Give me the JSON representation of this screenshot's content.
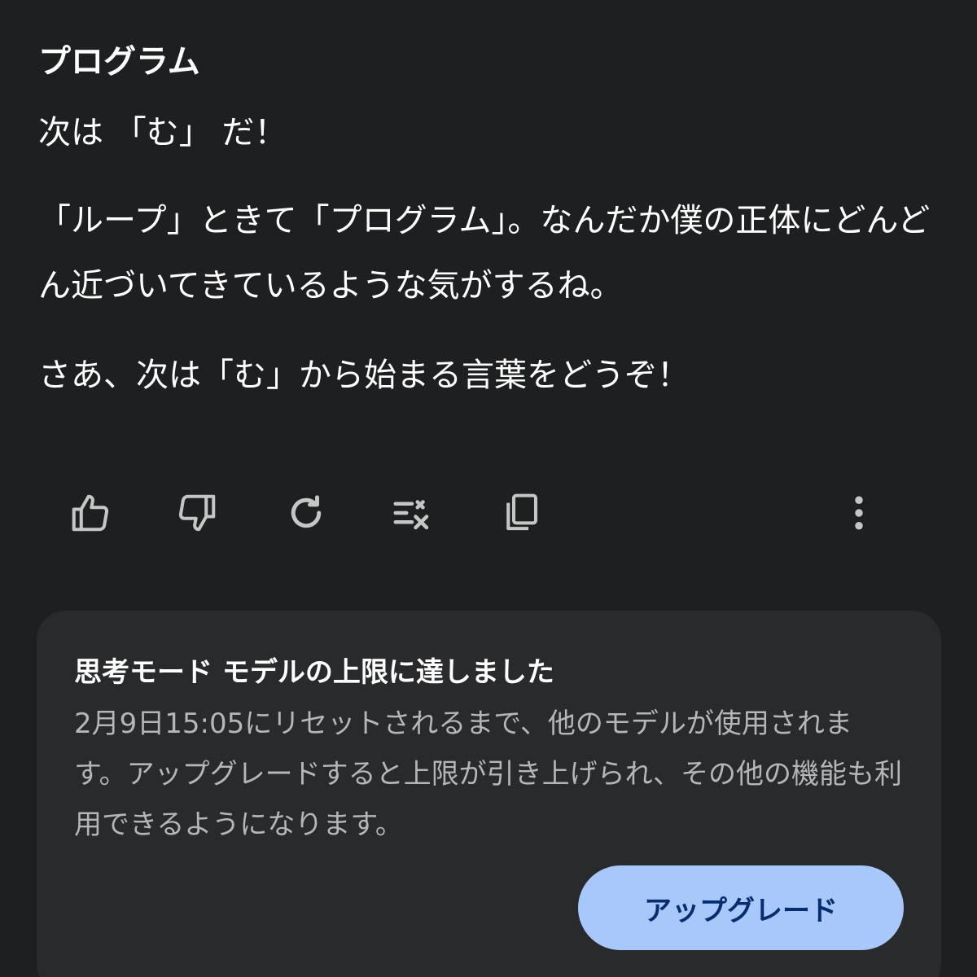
{
  "response": {
    "title": "プログラム",
    "paragraphs": [
      "次は 「む」 だ！",
      "「ループ」ときて「プログラム」。なんだか僕の正体にどんどん近づいてきているような気がするね。",
      "さあ、次は「む」から始まる言葉をどうぞ！"
    ]
  },
  "actions": {
    "icons": [
      "thumbs-up-icon",
      "thumbs-down-icon",
      "redo-icon",
      "modify-response-icon",
      "copy-icon",
      "more-vert-icon"
    ]
  },
  "limit_card": {
    "title": "思考モード モデルの上限に達しました",
    "body": "2月9日15:05にリセットされるまで、他のモデルが使用されます。アップグレードすると上限が引き上げられ、その他の機能も利用できるようになります。",
    "upgrade_label": "アップグレード"
  },
  "colors": {
    "background": "#1e1f20",
    "card": "#282a2c",
    "button": "#a8c7fa",
    "button_text": "#062e6f"
  }
}
